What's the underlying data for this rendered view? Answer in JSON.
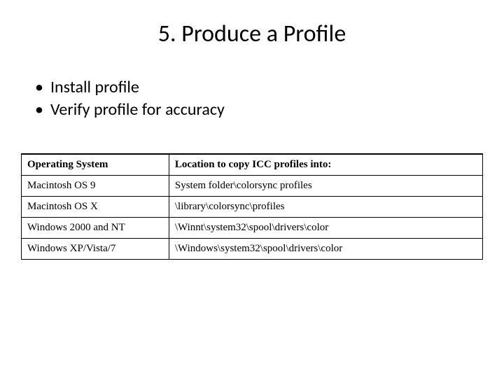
{
  "title": "5. Produce a Profile",
  "bullets": [
    "Install profile",
    "Verify profile for accuracy"
  ],
  "table": {
    "headers": [
      "Operating System",
      "Location to copy ICC profiles into:"
    ],
    "rows": [
      [
        "Macintosh OS 9",
        "System folder\\colorsync profiles"
      ],
      [
        "Macintosh OS X",
        "\\library\\colorsync\\profiles"
      ],
      [
        "Windows 2000 and NT",
        "\\Winnt\\system32\\spool\\drivers\\color"
      ],
      [
        "Windows XP/Vista/7",
        "\\Windows\\system32\\spool\\drivers\\color"
      ]
    ]
  }
}
